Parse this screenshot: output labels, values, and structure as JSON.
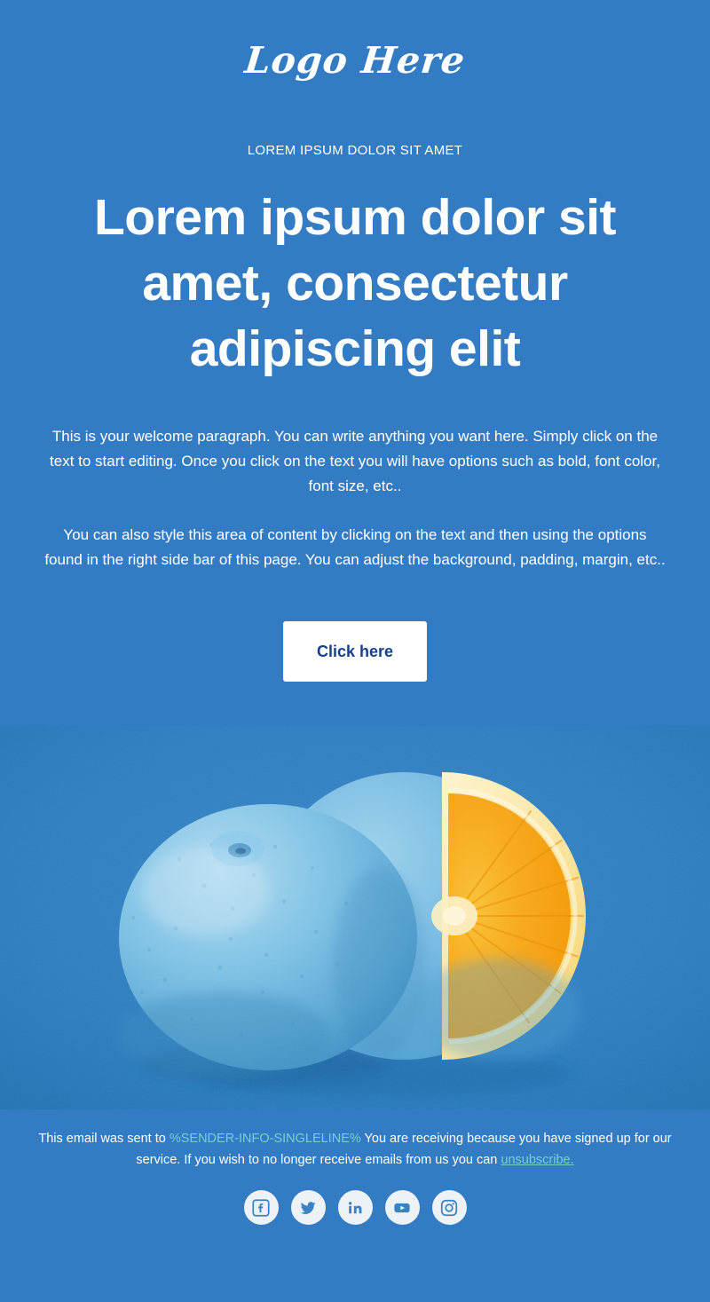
{
  "theme": {
    "background": "#337cc4",
    "image_background": "#2b7ec1",
    "text_color": "#ffffff",
    "accent_teal": "#74cfd4",
    "button_background": "#ffffff",
    "button_text_color": "#15408c",
    "social_circle_color": "#edf2f6"
  },
  "header": {
    "logo_text": "Logo Here"
  },
  "hero": {
    "eyebrow": "LOREM IPSUM DOLOR SIT AMET",
    "title": "Lorem ipsum dolor sit amet, consectetur adipiscing elit"
  },
  "body": {
    "paragraphs": [
      "This is your welcome paragraph. You can write anything you want here. Simply click on the text to start editing. Once you click on the text you will have options such as bold, font color, font size, etc..",
      "You can also style this area of content by clicking on the text and then using the options found in the right side bar of this page. You can adjust the background, padding, margin, etc.."
    ]
  },
  "cta": {
    "label": "Click here"
  },
  "hero_image": {
    "alt": "Two blue painted oranges, one cut open revealing orange flesh",
    "icon_name": "blue-oranges-photo"
  },
  "footer": {
    "text_before_tag": "This email was sent to ",
    "merge_tag": "%SENDER-INFO-SINGLELINE%",
    "text_after_tag": " You are receiving because you have signed up for our service. If you wish to no longer receive emails from us you can ",
    "unsubscribe_label": "unsubscribe.",
    "social_links": [
      {
        "name": "facebook",
        "icon": "facebook-icon"
      },
      {
        "name": "twitter",
        "icon": "twitter-icon"
      },
      {
        "name": "linkedin",
        "icon": "linkedin-icon"
      },
      {
        "name": "youtube",
        "icon": "youtube-icon"
      },
      {
        "name": "instagram",
        "icon": "instagram-icon"
      }
    ]
  }
}
